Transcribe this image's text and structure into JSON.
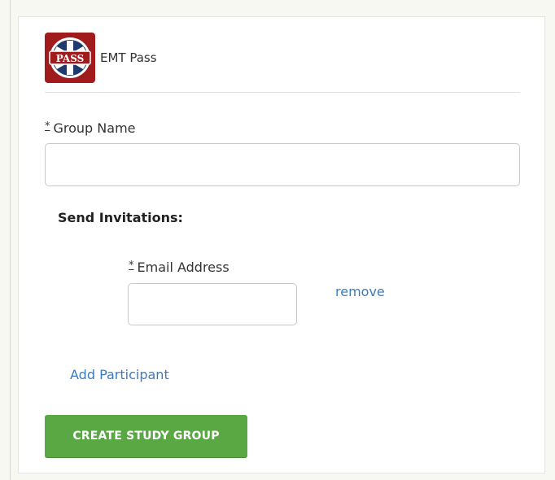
{
  "brand": {
    "logo_text": "PASS",
    "name": "EMT Pass"
  },
  "form": {
    "required_marker": "*",
    "group_name": {
      "label": "Group Name",
      "value": "",
      "placeholder": ""
    },
    "invitations": {
      "title": "Send Invitations:",
      "email": {
        "label": "Email Address",
        "value": "",
        "placeholder": ""
      },
      "remove_label": "remove",
      "add_label": "Add Participant"
    },
    "submit_label": "CREATE STUDY GROUP"
  },
  "colors": {
    "accent_green": "#5aa844",
    "link_blue": "#3b7bbf",
    "logo_red": "#a01c1c",
    "logo_navy": "#1f3b6e"
  }
}
